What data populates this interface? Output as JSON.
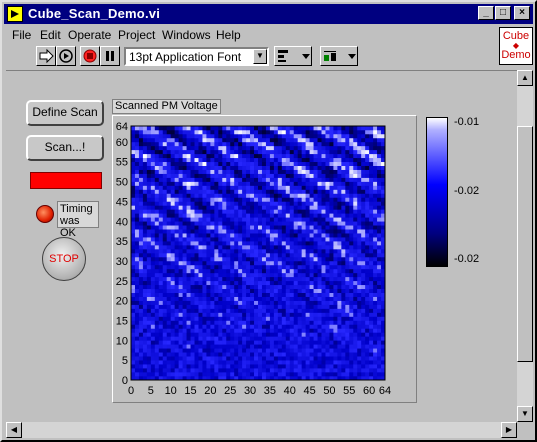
{
  "window": {
    "title": "Cube_Scan_Demo.vi"
  },
  "menu": [
    "File",
    "Edit",
    "Operate",
    "Project",
    "Windows",
    "Help"
  ],
  "toolbar": {
    "font": "13pt Application Font"
  },
  "logo": {
    "line1": "Cube",
    "line2": "Demo"
  },
  "controls": {
    "define_scan": "Define Scan",
    "scan": "Scan...!",
    "timing_label": "Timing was OK",
    "stop": "STOP"
  },
  "graph": {
    "label": "Scanned PM Voltage"
  },
  "chart_data": {
    "type": "heatmap",
    "title": "Scanned PM Voltage",
    "x_ticks": [
      "0",
      "5",
      "10",
      "15",
      "20",
      "25",
      "30",
      "35",
      "40",
      "45",
      "50",
      "55",
      "60",
      "64"
    ],
    "y_ticks": [
      "64",
      "60",
      "55",
      "50",
      "45",
      "40",
      "35",
      "30",
      "25",
      "20",
      "15",
      "10",
      "5",
      "0"
    ],
    "xlim": [
      0,
      64
    ],
    "ylim": [
      0,
      64
    ],
    "colorbar_ticks": [
      "-0.01",
      "-0.02",
      "-0.02"
    ],
    "colors": {
      "high": "#ffffff",
      "mid": "#0000ff",
      "low": "#000000"
    }
  }
}
